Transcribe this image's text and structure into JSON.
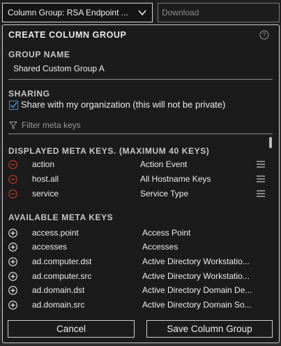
{
  "topbar": {
    "column_group_select": "Column Group: RSA Endpoint ...",
    "download_label": "Download"
  },
  "panel": {
    "title": "CREATE COLUMN GROUP",
    "group_name_label": "GROUP NAME",
    "group_name_value": "Shared Custom Group A",
    "sharing_label": "SHARING",
    "share_checkbox_label": "Share with my organization (this will not be private)",
    "share_checked": true,
    "filter_placeholder": "Filter meta keys",
    "displayed_heading": "DISPLAYED META KEYS. (MAXIMUM 40 KEYS)",
    "displayed_keys": [
      {
        "key": "action",
        "description": "Action Event"
      },
      {
        "key": "host.all",
        "description": "All Hostname Keys"
      },
      {
        "key": "service",
        "description": "Service Type"
      }
    ],
    "available_heading": "AVAILABLE META KEYS",
    "available_keys": [
      {
        "key": "access.point",
        "description": "Access Point"
      },
      {
        "key": "accesses",
        "description": "Accesses"
      },
      {
        "key": "ad.computer.dst",
        "description": "Active Directory Workstatio..."
      },
      {
        "key": "ad.computer.src",
        "description": "Active Directory Workstatio..."
      },
      {
        "key": "ad.domain.dst",
        "description": "Active Directory Domain De..."
      },
      {
        "key": "ad.domain.src",
        "description": "Active Directory Domain So..."
      }
    ],
    "cancel_label": "Cancel",
    "save_label": "Save Column Group"
  },
  "colors": {
    "remove_icon": "#c0392b",
    "checkbox": "#3b8fd6",
    "panel_bg": "#1b1b1b"
  },
  "icons": {
    "help": "question-circle-icon",
    "remove": "minus-circle-icon",
    "add": "plus-circle-icon",
    "drag": "drag-handle-icon",
    "filter": "filter-icon",
    "dropdown": "chevron-down-icon"
  }
}
